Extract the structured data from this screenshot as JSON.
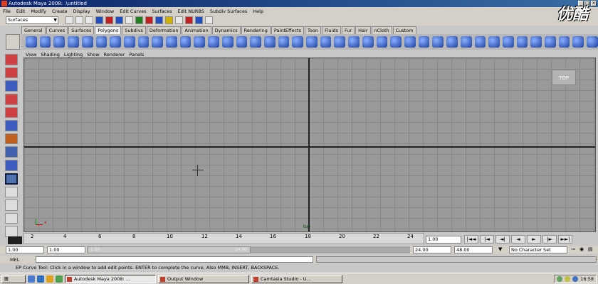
{
  "window": {
    "title": "Autodesk Maya 2008: .\\untitled"
  },
  "menubar": [
    "File",
    "Edit",
    "Modify",
    "Create",
    "Display",
    "Window",
    "Edit Curves",
    "Surfaces",
    "Edit NURBS",
    "Subdiv Surfaces",
    "Help"
  ],
  "status_line": {
    "mode": "Surfaces"
  },
  "shelf_tabs": [
    "General",
    "Curves",
    "Surfaces",
    "Polygons",
    "Subdivs",
    "Deformation",
    "Animation",
    "Dynamics",
    "Rendering",
    "PaintEffects",
    "Toon",
    "Fluids",
    "Fur",
    "Hair",
    "nCloth",
    "Custom"
  ],
  "active_shelf": "Polygons",
  "panel_menu": [
    "View",
    "Shading",
    "Lighting",
    "Show",
    "Renderer",
    "Panels"
  ],
  "viewport": {
    "camera_label": "TOP",
    "axis_x": "x",
    "axis_label": "top"
  },
  "time_slider": {
    "ticks": [
      "2",
      "4",
      "6",
      "8",
      "10",
      "12",
      "14",
      "16",
      "18",
      "20",
      "22",
      "24"
    ],
    "current_frame_input": "1.00"
  },
  "playback": {
    "buttons": [
      "|◄◄",
      "|◄",
      "◄|",
      "◄",
      "►",
      "|►",
      "►►|"
    ]
  },
  "range": {
    "start": "1.00",
    "min": "1.00",
    "slider_start": "1.00",
    "slider_end": "24.00",
    "end": "24.00",
    "max": "48.00",
    "character_set": "No Character Set"
  },
  "mel": {
    "label": "MEL"
  },
  "help_line": "EP Curve Tool: Click in a window to add edit points. ENTER to complete the curve. Also MMB, INSERT, BACKSPACE.",
  "taskbar": {
    "tasks": [
      "Autodesk Maya 2008: ...",
      "Output Window",
      "Camtasia Studio - U..."
    ],
    "clock": "16:58"
  },
  "watermark": "优酷"
}
